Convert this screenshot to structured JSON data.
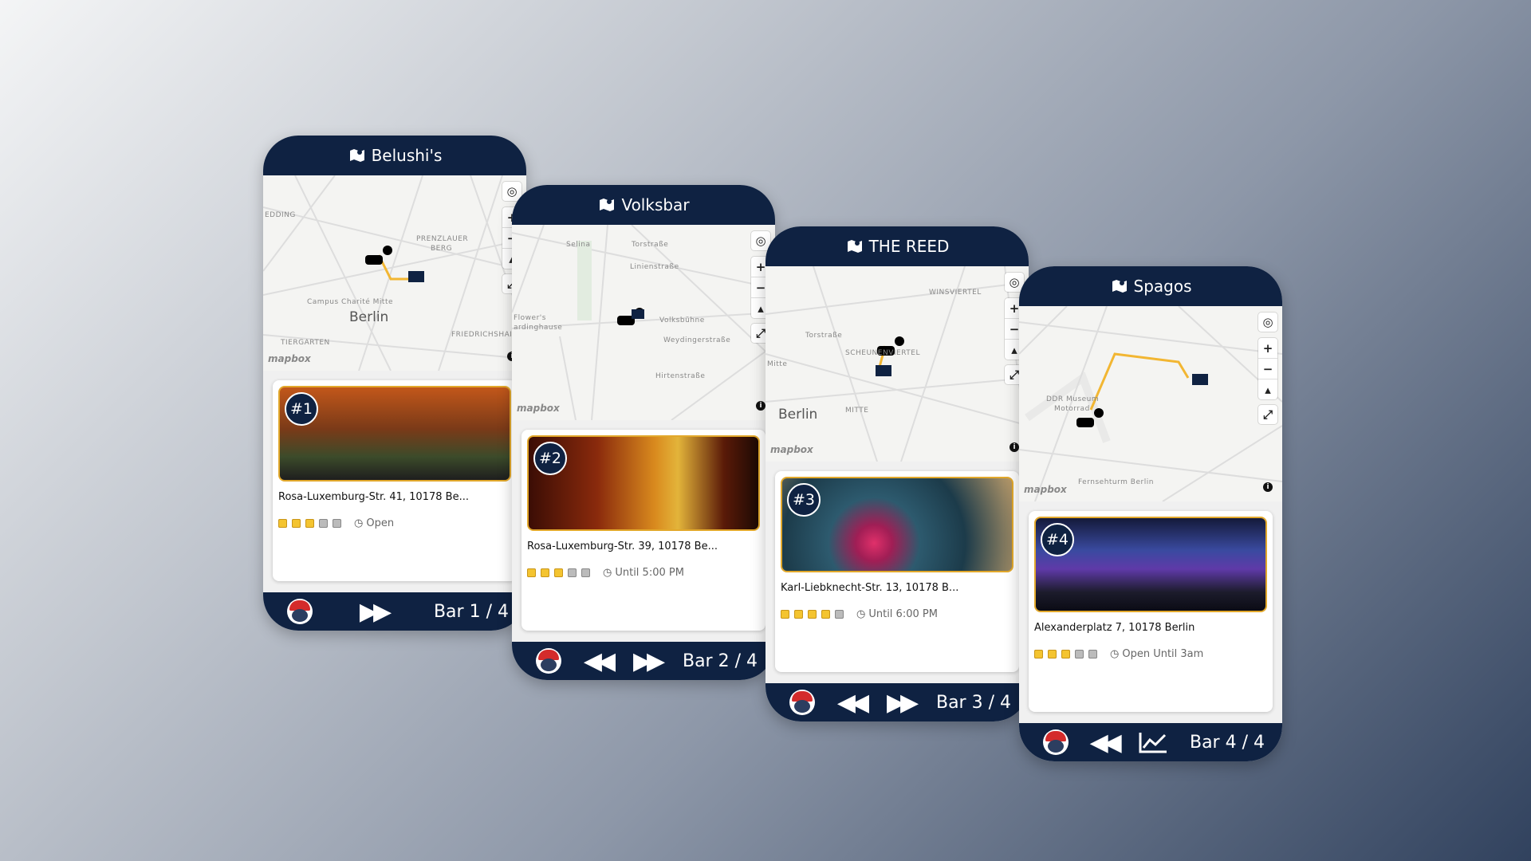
{
  "cards": [
    {
      "title": "Belushi's",
      "rank": "#1",
      "address": "Rosa-Luxemburg-Str. 41, 10178 Be...",
      "rating": 3,
      "hours": "Open",
      "bar_label": "Bar 1 / 4",
      "map_labels": {
        "city": "Berlin",
        "l1": "EDDING",
        "l2": "PRENZLAUER",
        "l3": "BERG",
        "l4": "Campus Charité Mitte",
        "l5": "TIERGARTEN",
        "l6": "FRIEDRICHSHAIN"
      }
    },
    {
      "title": "Volksbar",
      "rank": "#2",
      "address": "Rosa-Luxemburg-Str. 39, 10178 Be...",
      "rating": 3,
      "hours": "Until 5:00 PM",
      "bar_label": "Bar 2 / 4",
      "map_labels": {
        "l1": "Selina",
        "l2": "Torstraße",
        "l3": "Linienstraße",
        "l4": "Flower's",
        "l5": "ardinghause",
        "l6": "Volksbühne",
        "l7": "Weydingerstraße",
        "l8": "Hirtenstraße"
      }
    },
    {
      "title": "THE REED",
      "rank": "#3",
      "address": "Karl-Liebknecht-Str. 13, 10178 B...",
      "rating": 4,
      "hours": "Until 6:00 PM",
      "bar_label": "Bar 3 / 4",
      "map_labels": {
        "city": "Berlin",
        "l1": "WINSVIERTEL",
        "l2": "Torstraße",
        "l3": "SCHEUNENVIERTEL",
        "l4": "Mitte",
        "l5": "MITTE"
      }
    },
    {
      "title": "Spagos",
      "rank": "#4",
      "address": "Alexanderplatz 7, 10178 Berlin",
      "rating": 3,
      "hours": "Open Until 3am",
      "bar_label": "Bar 4 / 4",
      "map_labels": {
        "l1": "DDR Museum",
        "l2": "Motorrad",
        "l3": "Fernsehturm Berlin"
      }
    }
  ],
  "mapbox": "mapbox",
  "colors": {
    "navy": "#0f2242",
    "accent": "#e2a82b",
    "route": "#f2b632"
  },
  "icons": {
    "header": "map-marker-icon",
    "locate": "locate-icon",
    "zoom_in": "plus-icon",
    "zoom_out": "minus-icon",
    "compass": "compass-icon",
    "fullscreen": "fullscreen-icon",
    "info": "info-icon",
    "next": "fast-forward-icon",
    "prev": "rewind-icon",
    "stats": "chart-icon",
    "avatar": "mario-avatar-icon"
  }
}
